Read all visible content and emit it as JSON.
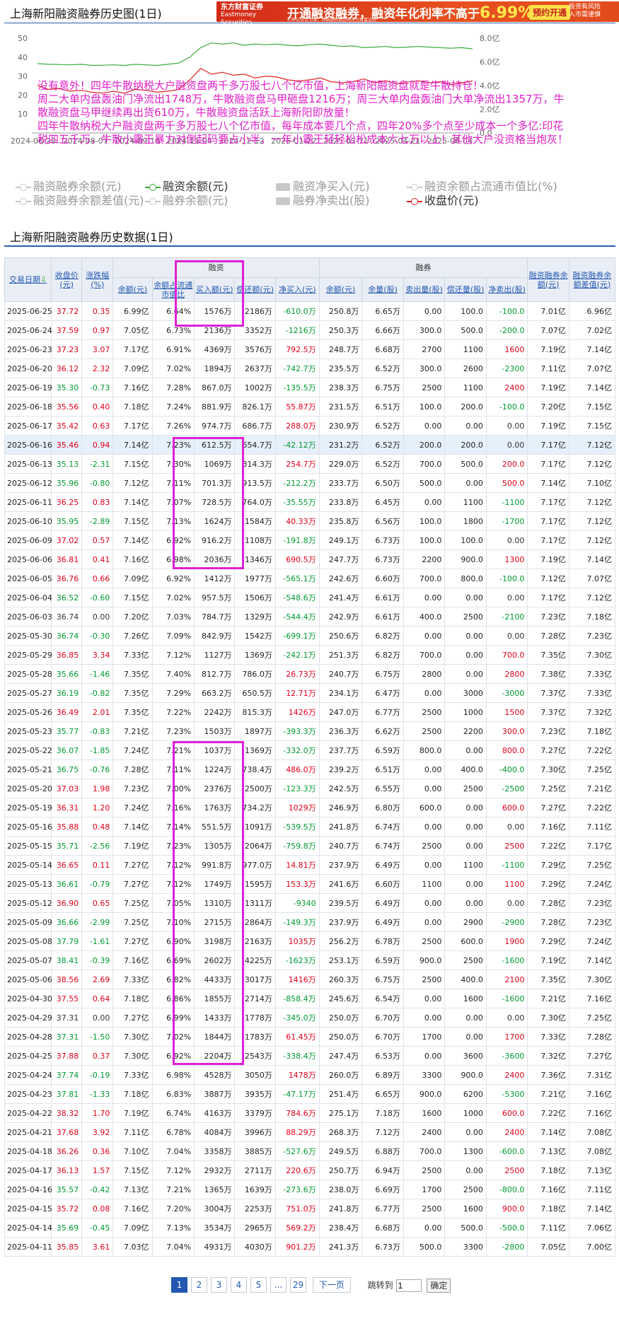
{
  "header": {
    "title": "上海新阳融资融券历史图(1日)",
    "ad": {
      "brand": "东方财富证券",
      "brand_en": "Eastmoney Securities",
      "headline": "开通融资融券，融资年化利率不高于",
      "rate": "6.99%",
      "rate_suffix": "！",
      "button": "预约开通",
      "small1": "投资有风险",
      "small2": "入市需谨慎",
      "sub": "利率以协议为准，详细规则请咨询东方财富证券"
    }
  },
  "chart_data": {
    "type": "line",
    "x_ticks": [
      "2024-06-28",
      "2024-08-07",
      "2024-09-18",
      "2024-11-04",
      "2024-12-12",
      "2025-01-22",
      "2025-03-11",
      "2025-04-21",
      "2025-06-04"
    ],
    "y_left_ticks": [
      "50",
      "40",
      "30",
      "20",
      "10"
    ],
    "y_right_ticks": [
      "8.0亿",
      "6.0亿",
      "4.0亿",
      "2.0亿",
      "0.0"
    ],
    "ylim_left": [
      10,
      50
    ],
    "ylim_right": [
      0,
      8
    ],
    "series": [
      {
        "name": "融资余额(元)",
        "color": "#3cab3c",
        "axis": "right",
        "values": [
          5.85,
          5.8,
          5.78,
          5.75,
          5.8,
          5.7,
          5.72,
          5.75,
          5.7,
          5.8,
          5.75,
          5.7,
          5.8,
          5.9,
          6.4,
          7.2,
          7.6,
          7.5,
          7.6,
          7.4,
          7.5,
          7.45,
          7.5,
          7.4,
          7.35,
          7.45,
          7.5,
          7.4,
          7.3,
          7.35,
          7.2,
          7.25,
          7.3,
          7.2,
          7.25,
          7.3,
          7.25,
          7.2,
          7.15,
          7.2,
          7.1
        ]
      },
      {
        "name": "收盘价(元)",
        "color": "#e02020",
        "axis": "left",
        "values": [
          35,
          33,
          33.5,
          32,
          32.5,
          31.5,
          31,
          32,
          31,
          33,
          32.5,
          31.5,
          32,
          33,
          38,
          44,
          41,
          42,
          40.5,
          41,
          39,
          40,
          39.5,
          38,
          37.5,
          38,
          39,
          37,
          36.5,
          37,
          38.5,
          36.5,
          37.5,
          36,
          36.8,
          37.5,
          36.5,
          37,
          35.5,
          36.5,
          37.5
        ]
      }
    ]
  },
  "overlay_text": [
    "没有意外！四年牛散纳税大户融资盘两千多万股七八个亿市值，上海新阳融资盘就是牛散持仓！",
    "周二大单内盘轰油门净流出1748万，牛散融资盘马甲砸盘1216万；周三大单内盘轰油门大单净流出1357万，牛散融资盘马甲继续再出货610万，牛散融资盘活跃上海新阳即放量！",
    "四年牛散纳税大户融资盘两千多万股七八个亿市值，每年成本要几个点，四年20%多个点至少成本一个多亿:印花税四五千万，牛散小霸王暴力对倒起码要占小半，一年小霸王轻轻松松成本六七万以上！其他大户没资格当炮灰！"
  ],
  "legend": [
    {
      "label": "融资融券余额(元)",
      "active": false,
      "style": "circle"
    },
    {
      "label": "融资余额(元)",
      "active": true,
      "style": "circle",
      "color": "#3cab3c"
    },
    {
      "label": "融资净买入(元)",
      "active": false,
      "style": "bar"
    },
    {
      "label": "融资余额占流通市值比(%)",
      "active": false,
      "style": "circle"
    },
    {
      "label": "融资融券余额差值(元)",
      "active": false,
      "style": "circle"
    },
    {
      "label": "融券余额(元)",
      "active": false,
      "style": "circle"
    },
    {
      "label": "融券净卖出(股)",
      "active": false,
      "style": "bar"
    },
    {
      "label": "收盘价(元)",
      "active": true,
      "style": "circle",
      "color": "#e02020"
    }
  ],
  "table": {
    "title": "上海新阳融资融券历史数据(1日)",
    "group_rz": "融资",
    "group_rq": "融券",
    "headers": [
      "交易日期",
      "收盘价(元)",
      "涨跌幅(%)",
      "余额(元)",
      "余额占流通市值比",
      "买入额(元)",
      "偿还额(元)",
      "净买入(元)",
      "余额(元)",
      "余量(股)",
      "卖出量(股)",
      "偿还量(股)",
      "净卖出(股)",
      "融资融券余额(元)",
      "融资融券余额差值(元)"
    ],
    "rows": [
      [
        "2025-06-25",
        "37.72",
        "0.35",
        "6.99亿",
        "6.64%",
        "1576万",
        "2186万",
        "-610.0万",
        "250.8万",
        "6.65万",
        "0.00",
        "100.0",
        "-100.0",
        "7.01亿",
        "6.96亿"
      ],
      [
        "2025-06-24",
        "37.59",
        "0.97",
        "7.05亿",
        "6.73%",
        "2136万",
        "3352万",
        "-1216万",
        "250.3万",
        "6.66万",
        "300.0",
        "500.0",
        "-200.0",
        "7.07亿",
        "7.02亿"
      ],
      [
        "2025-06-23",
        "37.23",
        "3.07",
        "7.17亿",
        "6.91%",
        "4369万",
        "3576万",
        "792.5万",
        "248.7万",
        "6.68万",
        "2700",
        "1100",
        "1600",
        "7.19亿",
        "7.14亿"
      ],
      [
        "2025-06-20",
        "36.12",
        "2.32",
        "7.09亿",
        "7.02%",
        "1894万",
        "2637万",
        "-742.7万",
        "235.5万",
        "6.52万",
        "300.0",
        "2600",
        "-2300",
        "7.11亿",
        "7.07亿"
      ],
      [
        "2025-06-19",
        "35.30",
        "-0.73",
        "7.16亿",
        "7.28%",
        "867.0万",
        "1002万",
        "-135.5万",
        "238.3万",
        "6.75万",
        "2500",
        "1100",
        "2400",
        "7.19亿",
        "7.14亿"
      ],
      [
        "2025-06-18",
        "35.56",
        "0.40",
        "7.18亿",
        "7.24%",
        "881.9万",
        "826.1万",
        "55.87万",
        "231.5万",
        "6.51万",
        "100.0",
        "200.0",
        "-100.0",
        "7.20亿",
        "7.15亿"
      ],
      [
        "2025-06-17",
        "35.42",
        "0.63",
        "7.17亿",
        "7.26%",
        "974.7万",
        "686.7万",
        "288.0万",
        "230.9万",
        "6.52万",
        "0.00",
        "0.00",
        "0.00",
        "7.19亿",
        "7.15亿"
      ],
      [
        "2025-06-16",
        "35.46",
        "0.94",
        "7.14亿",
        "7.23%",
        "612.5万",
        "654.7万",
        "-42.12万",
        "231.2万",
        "6.52万",
        "200.0",
        "200.0",
        "0.00",
        "7.17亿",
        "7.12亿"
      ],
      [
        "2025-06-13",
        "35.13",
        "-2.31",
        "7.15亿",
        "7.30%",
        "1069万",
        "814.3万",
        "254.7万",
        "229.0万",
        "6.52万",
        "700.0",
        "500.0",
        "200.0",
        "7.17亿",
        "7.12亿"
      ],
      [
        "2025-06-12",
        "35.96",
        "-0.80",
        "7.12亿",
        "7.11%",
        "701.3万",
        "913.5万",
        "-212.2万",
        "233.7万",
        "6.50万",
        "500.0",
        "0.00",
        "500.0",
        "7.14亿",
        "7.10亿"
      ],
      [
        "2025-06-11",
        "36.25",
        "0.83",
        "7.14亿",
        "7.07%",
        "728.5万",
        "764.0万",
        "-35.55万",
        "233.8万",
        "6.45万",
        "0.00",
        "1100",
        "-1100",
        "7.17亿",
        "7.12亿"
      ],
      [
        "2025-06-10",
        "35.95",
        "-2.89",
        "7.15亿",
        "7.13%",
        "1624万",
        "1584万",
        "40.33万",
        "235.8万",
        "6.56万",
        "100.0",
        "1800",
        "-1700",
        "7.17亿",
        "7.12亿"
      ],
      [
        "2025-06-09",
        "37.02",
        "0.57",
        "7.14亿",
        "6.92%",
        "916.2万",
        "1108万",
        "-191.8万",
        "249.1万",
        "6.73万",
        "100.0",
        "100.0",
        "0.00",
        "7.17亿",
        "7.12亿"
      ],
      [
        "2025-06-06",
        "36.81",
        "0.41",
        "7.16亿",
        "6.98%",
        "2036万",
        "1346万",
        "690.5万",
        "247.7万",
        "6.73万",
        "2200",
        "900.0",
        "1300",
        "7.19亿",
        "7.14亿"
      ],
      [
        "2025-06-05",
        "36.76",
        "0.66",
        "7.09亿",
        "6.92%",
        "1412万",
        "1977万",
        "-565.1万",
        "242.6万",
        "6.60万",
        "700.0",
        "800.0",
        "-100.0",
        "7.12亿",
        "7.07亿"
      ],
      [
        "2025-06-04",
        "36.52",
        "-0.60",
        "7.15亿",
        "7.02%",
        "957.5万",
        "1506万",
        "-548.6万",
        "241.4万",
        "6.61万",
        "0.00",
        "0.00",
        "0.00",
        "7.17亿",
        "7.12亿"
      ],
      [
        "2025-06-03",
        "36.74",
        "0.00",
        "7.20亿",
        "7.03%",
        "784.7万",
        "1329万",
        "-544.4万",
        "242.9万",
        "6.61万",
        "400.0",
        "2500",
        "-2100",
        "7.23亿",
        "7.18亿"
      ],
      [
        "2025-05-30",
        "36.74",
        "-0.30",
        "7.26亿",
        "7.09%",
        "842.9万",
        "1542万",
        "-699.1万",
        "250.6万",
        "6.82万",
        "0.00",
        "0.00",
        "0.00",
        "7.28亿",
        "7.23亿"
      ],
      [
        "2025-05-29",
        "36.85",
        "3.34",
        "7.33亿",
        "7.12%",
        "1127万",
        "1369万",
        "-242.1万",
        "251.3万",
        "6.82万",
        "700.0",
        "0.00",
        "700.0",
        "7.35亿",
        "7.30亿"
      ],
      [
        "2025-05-28",
        "35.66",
        "-1.46",
        "7.35亿",
        "7.40%",
        "812.7万",
        "786.0万",
        "26.73万",
        "240.7万",
        "6.75万",
        "2800",
        "0.00",
        "2800",
        "7.38亿",
        "7.33亿"
      ],
      [
        "2025-05-27",
        "36.19",
        "-0.82",
        "7.35亿",
        "7.29%",
        "663.2万",
        "650.5万",
        "12.71万",
        "234.1万",
        "6.47万",
        "0.00",
        "3000",
        "-3000",
        "7.37亿",
        "7.33亿"
      ],
      [
        "2025-05-26",
        "36.49",
        "2.01",
        "7.35亿",
        "7.22%",
        "2242万",
        "815.3万",
        "1426万",
        "247.0万",
        "6.77万",
        "2500",
        "1000",
        "1500",
        "7.37亿",
        "7.32亿"
      ],
      [
        "2025-05-23",
        "35.77",
        "-0.83",
        "7.21亿",
        "7.23%",
        "1503万",
        "1897万",
        "-393.3万",
        "236.3万",
        "6.62万",
        "2500",
        "2200",
        "300.0",
        "7.23亿",
        "7.18亿"
      ],
      [
        "2025-05-22",
        "36.07",
        "-1.85",
        "7.24亿",
        "7.21%",
        "1037万",
        "1369万",
        "-332.0万",
        "237.7万",
        "6.59万",
        "800.0",
        "0.00",
        "800.0",
        "7.27亿",
        "7.22亿"
      ],
      [
        "2025-05-21",
        "36.75",
        "-0.76",
        "7.28亿",
        "7.11%",
        "1224万",
        "738.4万",
        "486.0万",
        "239.2万",
        "6.51万",
        "0.00",
        "400.0",
        "-400.0",
        "7.30亿",
        "7.25亿"
      ],
      [
        "2025-05-20",
        "37.03",
        "1.98",
        "7.23亿",
        "7.00%",
        "2376万",
        "2500万",
        "-123.3万",
        "242.5万",
        "6.55万",
        "0.00",
        "2500",
        "-2500",
        "7.25亿",
        "7.21亿"
      ],
      [
        "2025-05-19",
        "36.31",
        "1.20",
        "7.24亿",
        "7.16%",
        "1763万",
        "734.2万",
        "1029万",
        "246.9万",
        "6.80万",
        "600.0",
        "0.00",
        "600.0",
        "7.27亿",
        "7.22亿"
      ],
      [
        "2025-05-16",
        "35.88",
        "0.48",
        "7.14亿",
        "7.14%",
        "551.5万",
        "1091万",
        "-539.5万",
        "241.8万",
        "6.74万",
        "0.00",
        "0.00",
        "0.00",
        "7.16亿",
        "7.11亿"
      ],
      [
        "2025-05-15",
        "35.71",
        "-2.56",
        "7.19亿",
        "7.23%",
        "1305万",
        "2064万",
        "-759.8万",
        "240.7万",
        "6.74万",
        "2500",
        "0.00",
        "2500",
        "7.22亿",
        "7.17亿"
      ],
      [
        "2025-05-14",
        "36.65",
        "0.11",
        "7.27亿",
        "7.12%",
        "991.8万",
        "977.0万",
        "14.81万",
        "237.9万",
        "6.49万",
        "0.00",
        "1100",
        "-1100",
        "7.29亿",
        "7.25亿"
      ],
      [
        "2025-05-13",
        "36.61",
        "-0.79",
        "7.27亿",
        "7.12%",
        "1749万",
        "1595万",
        "153.3万",
        "241.6万",
        "6.60万",
        "1100",
        "0.00",
        "1100",
        "7.29亿",
        "7.24亿"
      ],
      [
        "2025-05-12",
        "36.90",
        "0.65",
        "7.25亿",
        "7.05%",
        "1310万",
        "1311万",
        "-9340",
        "239.5万",
        "6.49万",
        "0.00",
        "0.00",
        "0.00",
        "7.28亿",
        "7.23亿"
      ],
      [
        "2025-05-09",
        "36.66",
        "-2.99",
        "7.25亿",
        "7.10%",
        "2715万",
        "2864万",
        "-149.3万",
        "237.9万",
        "6.49万",
        "0.00",
        "2900",
        "-2900",
        "7.28亿",
        "7.23亿"
      ],
      [
        "2025-05-08",
        "37.79",
        "-1.61",
        "7.27亿",
        "6.90%",
        "3198万",
        "2163万",
        "1035万",
        "256.2万",
        "6.78万",
        "2500",
        "600.0",
        "1900",
        "7.29亿",
        "7.24亿"
      ],
      [
        "2025-05-07",
        "38.41",
        "-0.39",
        "7.16亿",
        "6.69%",
        "2602万",
        "4225万",
        "-1623万",
        "253.1万",
        "6.59万",
        "900.0",
        "2500",
        "-1600",
        "7.19亿",
        "7.14亿"
      ],
      [
        "2025-05-06",
        "38.56",
        "2.69",
        "7.33亿",
        "6.82%",
        "4433万",
        "3017万",
        "1416万",
        "260.3万",
        "6.75万",
        "2500",
        "400.0",
        "2100",
        "7.35亿",
        "7.30亿"
      ],
      [
        "2025-04-30",
        "37.55",
        "0.64",
        "7.18亿",
        "6.86%",
        "1855万",
        "2714万",
        "-858.4万",
        "245.6万",
        "6.54万",
        "0.00",
        "1600",
        "-1600",
        "7.21亿",
        "7.16亿"
      ],
      [
        "2025-04-29",
        "37.31",
        "0.00",
        "7.27亿",
        "6.99%",
        "1433万",
        "1778万",
        "-345.0万",
        "250.0万",
        "6.70万",
        "0.00",
        "0.00",
        "0.00",
        "7.30亿",
        "7.25亿"
      ],
      [
        "2025-04-28",
        "37.31",
        "-1.50",
        "7.30亿",
        "7.02%",
        "1844万",
        "1783万",
        "61.45万",
        "250.0万",
        "6.70万",
        "1700",
        "0.00",
        "1700",
        "7.33亿",
        "7.28亿"
      ],
      [
        "2025-04-25",
        "37.88",
        "0.37",
        "7.30亿",
        "6.92%",
        "2204万",
        "2543万",
        "-338.4万",
        "247.4万",
        "6.53万",
        "0.00",
        "3600",
        "-3600",
        "7.32亿",
        "7.27亿"
      ],
      [
        "2025-04-24",
        "37.74",
        "-0.19",
        "7.33亿",
        "6.98%",
        "4528万",
        "3050万",
        "1478万",
        "260.0万",
        "6.89万",
        "3300",
        "900.0",
        "2400",
        "7.36亿",
        "7.31亿"
      ],
      [
        "2025-04-23",
        "37.81",
        "-1.33",
        "7.18亿",
        "6.83%",
        "3887万",
        "3935万",
        "-47.17万",
        "251.4万",
        "6.65万",
        "900.0",
        "6200",
        "-5300",
        "7.21亿",
        "7.16亿"
      ],
      [
        "2025-04-22",
        "38.32",
        "1.70",
        "7.19亿",
        "6.74%",
        "4163万",
        "3379万",
        "784.6万",
        "275.1万",
        "7.18万",
        "1600",
        "1000",
        "600.0",
        "7.22亿",
        "7.16亿"
      ],
      [
        "2025-04-21",
        "37.68",
        "3.92",
        "7.11亿",
        "6.78%",
        "4084万",
        "3996万",
        "88.29万",
        "268.3万",
        "7.12万",
        "2400",
        "0.00",
        "2400",
        "7.14亿",
        "7.08亿"
      ],
      [
        "2025-04-18",
        "36.26",
        "0.36",
        "7.10亿",
        "7.04%",
        "3358万",
        "3885万",
        "-527.6万",
        "249.5万",
        "6.88万",
        "700.0",
        "1300",
        "-600.0",
        "7.13亿",
        "7.08亿"
      ],
      [
        "2025-04-17",
        "36.13",
        "1.57",
        "7.15亿",
        "7.12%",
        "2932万",
        "2711万",
        "220.6万",
        "250.7万",
        "6.94万",
        "2500",
        "0.00",
        "2500",
        "7.18亿",
        "7.13亿"
      ],
      [
        "2025-04-16",
        "35.57",
        "-0.42",
        "7.13亿",
        "7.21%",
        "1365万",
        "1639万",
        "-273.6万",
        "238.0万",
        "6.69万",
        "1700",
        "2500",
        "-800.0",
        "7.16亿",
        "7.11亿"
      ],
      [
        "2025-04-15",
        "35.72",
        "0.08",
        "7.16亿",
        "7.20%",
        "3004万",
        "2253万",
        "751.0万",
        "241.8万",
        "6.77万",
        "2500",
        "1600",
        "900.0",
        "7.18亿",
        "7.14亿"
      ],
      [
        "2025-04-14",
        "35.69",
        "-0.45",
        "7.09亿",
        "7.13%",
        "3534万",
        "2965万",
        "569.2万",
        "238.4万",
        "6.68万",
        "0.00",
        "500.0",
        "-500.0",
        "7.11亿",
        "7.06亿"
      ],
      [
        "2025-04-11",
        "35.85",
        "3.61",
        "7.03亿",
        "7.04%",
        "4931万",
        "4030万",
        "901.2万",
        "241.3万",
        "6.73万",
        "500.0",
        "3300",
        "-2800",
        "7.05亿",
        "7.00亿"
      ]
    ],
    "highlight_row": 7
  },
  "pager": {
    "pages": [
      "1",
      "2",
      "3",
      "4",
      "5",
      "...",
      "29"
    ],
    "active": "1",
    "next": "下一页",
    "jump_label": "跳转到",
    "jump_value": "1",
    "go": "确定"
  }
}
